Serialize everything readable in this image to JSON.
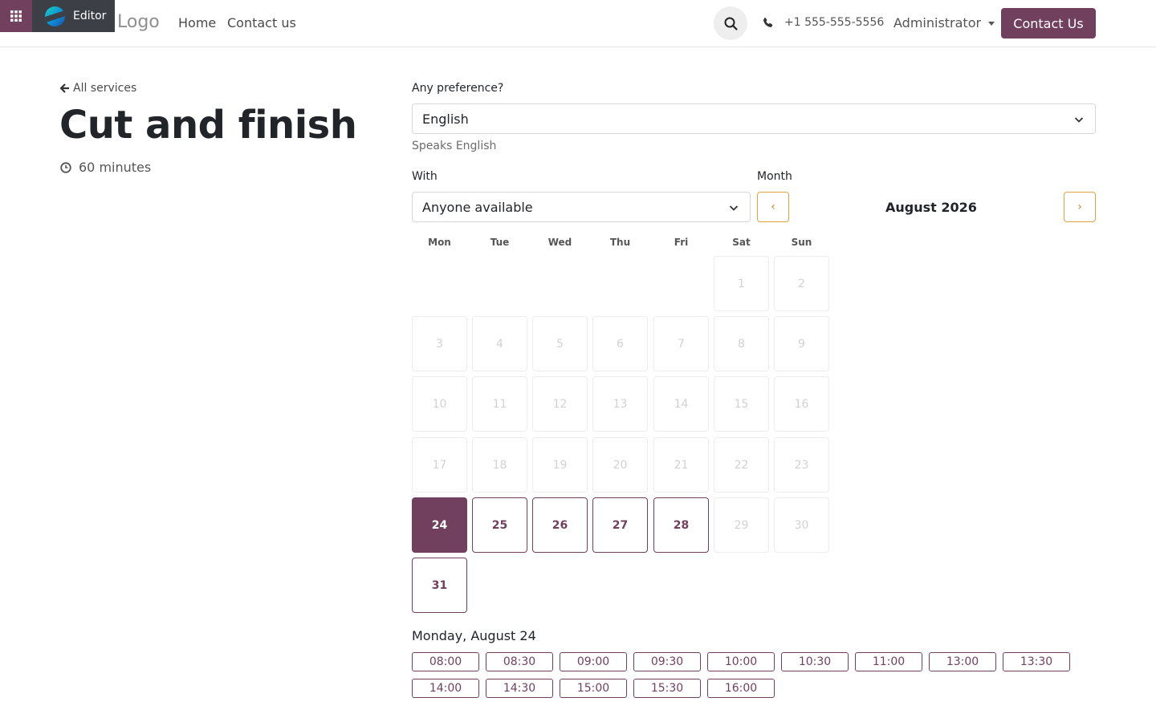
{
  "header": {
    "editor_label": "Editor",
    "logo_text": "Logo",
    "nav": [
      {
        "label": "Home"
      },
      {
        "label": "Contact us"
      }
    ],
    "phone": "+1 555-555-5556",
    "user": "Administrator",
    "cta": "Contact Us"
  },
  "service": {
    "back_label": "All services",
    "title": "Cut and finish",
    "duration": "60 minutes"
  },
  "form": {
    "preference_label": "Any preference?",
    "preference_value": "English",
    "preference_hint": "Speaks English",
    "with_label": "With",
    "with_value": "Anyone available",
    "month_label": "Month"
  },
  "calendar": {
    "prev": "‹",
    "next": "›",
    "month_title": "August 2026",
    "weekdays": [
      "Mon",
      "Tue",
      "Wed",
      "Thu",
      "Fri",
      "Sat",
      "Sun"
    ],
    "days": [
      {
        "n": "1",
        "state": "disabled"
      },
      {
        "n": "2",
        "state": "disabled"
      },
      {
        "n": "3",
        "state": "disabled"
      },
      {
        "n": "4",
        "state": "disabled"
      },
      {
        "n": "5",
        "state": "disabled"
      },
      {
        "n": "6",
        "state": "disabled"
      },
      {
        "n": "7",
        "state": "disabled"
      },
      {
        "n": "8",
        "state": "disabled"
      },
      {
        "n": "9",
        "state": "disabled"
      },
      {
        "n": "10",
        "state": "disabled"
      },
      {
        "n": "11",
        "state": "disabled"
      },
      {
        "n": "12",
        "state": "disabled"
      },
      {
        "n": "13",
        "state": "disabled"
      },
      {
        "n": "14",
        "state": "disabled"
      },
      {
        "n": "15",
        "state": "disabled"
      },
      {
        "n": "16",
        "state": "disabled"
      },
      {
        "n": "17",
        "state": "disabled"
      },
      {
        "n": "18",
        "state": "disabled"
      },
      {
        "n": "19",
        "state": "disabled"
      },
      {
        "n": "20",
        "state": "disabled"
      },
      {
        "n": "21",
        "state": "disabled"
      },
      {
        "n": "22",
        "state": "disabled"
      },
      {
        "n": "23",
        "state": "disabled"
      },
      {
        "n": "24",
        "state": "selected"
      },
      {
        "n": "25",
        "state": "available"
      },
      {
        "n": "26",
        "state": "available"
      },
      {
        "n": "27",
        "state": "available"
      },
      {
        "n": "28",
        "state": "available"
      },
      {
        "n": "29",
        "state": "disabled"
      },
      {
        "n": "30",
        "state": "disabled"
      },
      {
        "n": "31",
        "state": "available"
      }
    ]
  },
  "slots": {
    "heading": "Monday, August 24",
    "times": [
      "08:00",
      "08:30",
      "09:00",
      "09:30",
      "10:00",
      "10:30",
      "11:00",
      "13:00",
      "13:30",
      "14:00",
      "14:30",
      "15:00",
      "15:30",
      "16:00"
    ]
  },
  "colors": {
    "brand": "#71405f",
    "nav_accent": "#e3a23d"
  }
}
